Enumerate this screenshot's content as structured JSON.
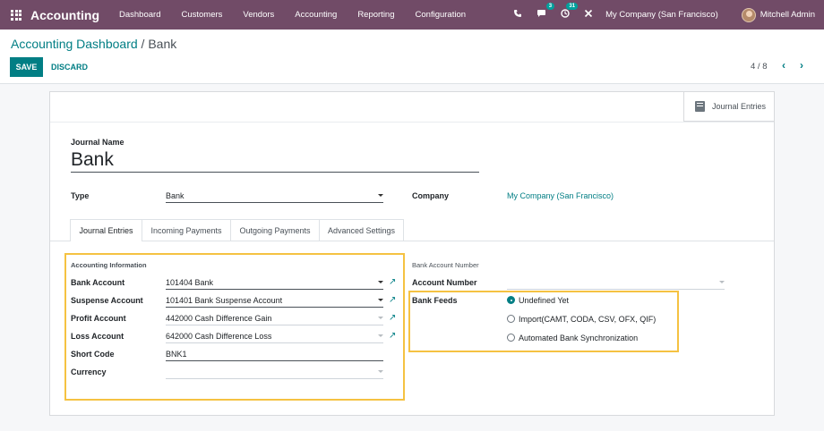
{
  "navbar": {
    "app_name": "Accounting",
    "menu": [
      "Dashboard",
      "Customers",
      "Vendors",
      "Accounting",
      "Reporting",
      "Configuration"
    ],
    "messages_badge": "3",
    "activities_badge": "31",
    "company": "My Company (San Francisco)",
    "user": "Mitchell Admin"
  },
  "breadcrumb": {
    "parent": "Accounting Dashboard",
    "separator": "/",
    "current": "Bank"
  },
  "actions": {
    "save": "SAVE",
    "discard": "DISCARD"
  },
  "pager": {
    "value": "4 / 8",
    "prev": "‹",
    "next": "›"
  },
  "smart_button": {
    "label": "Journal Entries"
  },
  "form": {
    "journal_name_label": "Journal Name",
    "journal_name": "Bank",
    "type_label": "Type",
    "type_value": "Bank",
    "company_label": "Company",
    "company_value": "My Company (San Francisco)"
  },
  "tabs": [
    "Journal Entries",
    "Incoming Payments",
    "Outgoing Payments",
    "Advanced Settings"
  ],
  "accounting_info": {
    "section_title": "Accounting Information",
    "bank_account_label": "Bank Account",
    "bank_account": "101404 Bank",
    "suspense_account_label": "Suspense Account",
    "suspense_account": "101401 Bank Suspense Account",
    "profit_account_label": "Profit Account",
    "profit_account": "442000 Cash Difference Gain",
    "loss_account_label": "Loss Account",
    "loss_account": "642000 Cash Difference Loss",
    "short_code_label": "Short Code",
    "short_code": "BNK1",
    "currency_label": "Currency",
    "currency": ""
  },
  "bank_account_number": {
    "section_title": "Bank Account Number",
    "account_number_label": "Account Number",
    "account_number": "",
    "bank_feeds_label": "Bank Feeds",
    "options": [
      "Undefined Yet",
      "Import(CAMT, CODA, CSV, OFX, QIF)",
      "Automated Bank Synchronization"
    ],
    "selected": "Undefined Yet"
  },
  "colors": {
    "navbar": "#714B67",
    "primary": "#017E84",
    "highlight": "#F5C242"
  }
}
